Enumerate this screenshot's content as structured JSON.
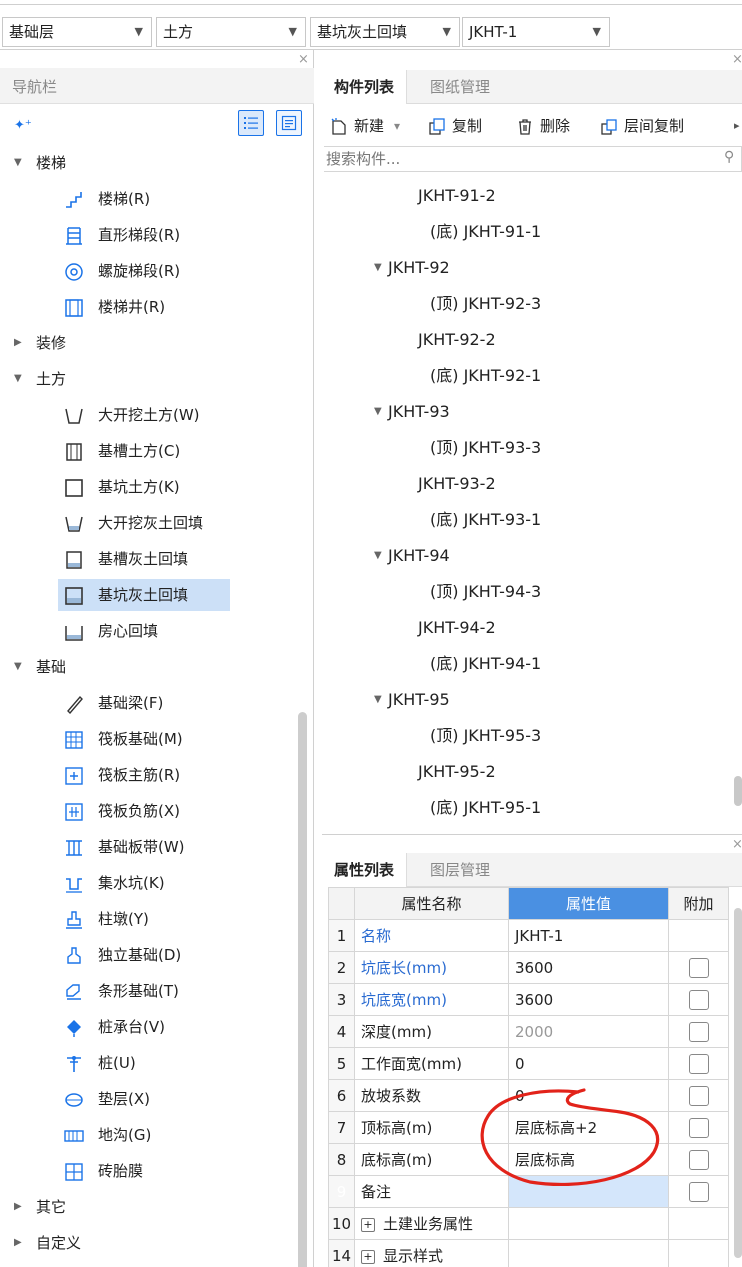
{
  "topbar": {
    "floor": "基础层",
    "category": "土方",
    "type": "基坑灰土回填",
    "component": "JKHT-1"
  },
  "nav": {
    "title": "导航栏",
    "close": "×",
    "tree": [
      {
        "kind": "cat",
        "caret": "▼",
        "label": "楼梯"
      },
      {
        "kind": "item",
        "icon": "stair-icon",
        "label": "楼梯(R)"
      },
      {
        "kind": "item",
        "icon": "straight-flight-icon",
        "label": "直形梯段(R)"
      },
      {
        "kind": "item",
        "icon": "spiral-flight-icon",
        "label": "螺旋梯段(R)"
      },
      {
        "kind": "item",
        "icon": "stairwell-icon",
        "label": "楼梯井(R)"
      },
      {
        "kind": "cat",
        "caret": "▶",
        "label": "装修"
      },
      {
        "kind": "cat",
        "caret": "▼",
        "label": "土方"
      },
      {
        "kind": "item",
        "icon": "open-excavation-icon",
        "label": "大开挖土方(W)"
      },
      {
        "kind": "item",
        "icon": "trench-icon",
        "label": "基槽土方(C)"
      },
      {
        "kind": "item",
        "icon": "pit-icon",
        "label": "基坑土方(K)"
      },
      {
        "kind": "item",
        "icon": "open-backfill-icon",
        "label": "大开挖灰土回填"
      },
      {
        "kind": "item",
        "icon": "trench-backfill-icon",
        "label": "基槽灰土回填"
      },
      {
        "kind": "item",
        "icon": "pit-backfill-icon",
        "label": "基坑灰土回填",
        "selected": true
      },
      {
        "kind": "item",
        "icon": "room-backfill-icon",
        "label": "房心回填"
      },
      {
        "kind": "cat",
        "caret": "▼",
        "label": "基础"
      },
      {
        "kind": "item",
        "icon": "foundation-beam-icon",
        "label": "基础梁(F)"
      },
      {
        "kind": "item",
        "icon": "raft-icon",
        "label": "筏板基础(M)"
      },
      {
        "kind": "item",
        "icon": "raft-main-rebar-icon",
        "label": "筏板主筋(R)"
      },
      {
        "kind": "item",
        "icon": "raft-neg-rebar-icon",
        "label": "筏板负筋(X)"
      },
      {
        "kind": "item",
        "icon": "foundation-strip-icon",
        "label": "基础板带(W)"
      },
      {
        "kind": "item",
        "icon": "sump-icon",
        "label": "集水坑(K)"
      },
      {
        "kind": "item",
        "icon": "pier-icon",
        "label": "柱墩(Y)"
      },
      {
        "kind": "item",
        "icon": "isolated-footing-icon",
        "label": "独立基础(D)"
      },
      {
        "kind": "item",
        "icon": "strip-footing-icon",
        "label": "条形基础(T)"
      },
      {
        "kind": "item",
        "icon": "pile-cap-icon",
        "label": "桩承台(V)"
      },
      {
        "kind": "item",
        "icon": "pile-icon",
        "label": "桩(U)"
      },
      {
        "kind": "item",
        "icon": "cushion-icon",
        "label": "垫层(X)"
      },
      {
        "kind": "item",
        "icon": "ditch-icon",
        "label": "地沟(G)"
      },
      {
        "kind": "item",
        "icon": "brick-mould-icon",
        "label": "砖胎膜"
      },
      {
        "kind": "cat",
        "caret": "▶",
        "label": "其它"
      },
      {
        "kind": "cat",
        "caret": "▶",
        "label": "自定义"
      }
    ]
  },
  "comp_panel": {
    "tabs": [
      "构件列表",
      "图纸管理"
    ],
    "toolbar": {
      "new": "新建",
      "new_arrow": "▾",
      "copy": "复制",
      "delete": "删除",
      "floor_copy": "层间复制"
    },
    "search_placeholder": "搜索构件...",
    "rows": [
      {
        "level": 2,
        "text": "JKHT-91-2"
      },
      {
        "level": 3,
        "text": "(底) JKHT-91-1"
      },
      {
        "level": 1,
        "caret": "▼",
        "text": "JKHT-92"
      },
      {
        "level": 3,
        "text": "(顶) JKHT-92-3"
      },
      {
        "level": 2,
        "text": "JKHT-92-2"
      },
      {
        "level": 3,
        "text": "(底) JKHT-92-1"
      },
      {
        "level": 1,
        "caret": "▼",
        "text": "JKHT-93"
      },
      {
        "level": 3,
        "text": "(顶) JKHT-93-3"
      },
      {
        "level": 2,
        "text": "JKHT-93-2"
      },
      {
        "level": 3,
        "text": "(底) JKHT-93-1"
      },
      {
        "level": 1,
        "caret": "▼",
        "text": "JKHT-94"
      },
      {
        "level": 3,
        "text": "(顶) JKHT-94-3"
      },
      {
        "level": 2,
        "text": "JKHT-94-2"
      },
      {
        "level": 3,
        "text": "(底) JKHT-94-1"
      },
      {
        "level": 1,
        "caret": "▼",
        "text": "JKHT-95"
      },
      {
        "level": 3,
        "text": "(顶) JKHT-95-3"
      },
      {
        "level": 2,
        "text": "JKHT-95-2"
      },
      {
        "level": 3,
        "text": "(底) JKHT-95-1"
      }
    ]
  },
  "prop_panel": {
    "tabs": [
      "属性列表",
      "图层管理"
    ],
    "headers": {
      "name": "属性名称",
      "value": "属性值",
      "extra": "附加"
    },
    "rows": [
      {
        "num": "1",
        "name": "名称",
        "value": "JKHT-1",
        "name_style": "blue",
        "checkbox": false
      },
      {
        "num": "2",
        "name": "坑底长(mm)",
        "value": "3600",
        "name_style": "blue",
        "checkbox": true
      },
      {
        "num": "3",
        "name": "坑底宽(mm)",
        "value": "3600",
        "name_style": "blue",
        "checkbox": true
      },
      {
        "num": "4",
        "name": "深度(mm)",
        "value": "2000",
        "name_style": "normal",
        "value_style": "gray",
        "checkbox": true
      },
      {
        "num": "5",
        "name": "工作面宽(mm)",
        "value": "0",
        "name_style": "normal",
        "checkbox": true
      },
      {
        "num": "6",
        "name": "放坡系数",
        "value": "0",
        "name_style": "normal",
        "checkbox": true
      },
      {
        "num": "7",
        "name": "顶标高(m)",
        "value": "层底标高+2",
        "name_style": "normal",
        "checkbox": true
      },
      {
        "num": "8",
        "name": "底标高(m)",
        "value": "层底标高",
        "name_style": "normal",
        "checkbox": true
      },
      {
        "num": "9",
        "name": "备注",
        "value": "",
        "name_style": "normal",
        "checkbox": true,
        "selected": true
      },
      {
        "num": "10",
        "name": "土建业务属性",
        "value": "",
        "name_style": "normal",
        "checkbox": false,
        "expand": "+"
      },
      {
        "num": "14",
        "name": "显示样式",
        "value": "",
        "name_style": "normal",
        "checkbox": false,
        "expand": "+"
      }
    ]
  },
  "colors": {
    "accent": "#4a90e2",
    "selection": "#cce0f7",
    "annotation": "#e2231a"
  }
}
